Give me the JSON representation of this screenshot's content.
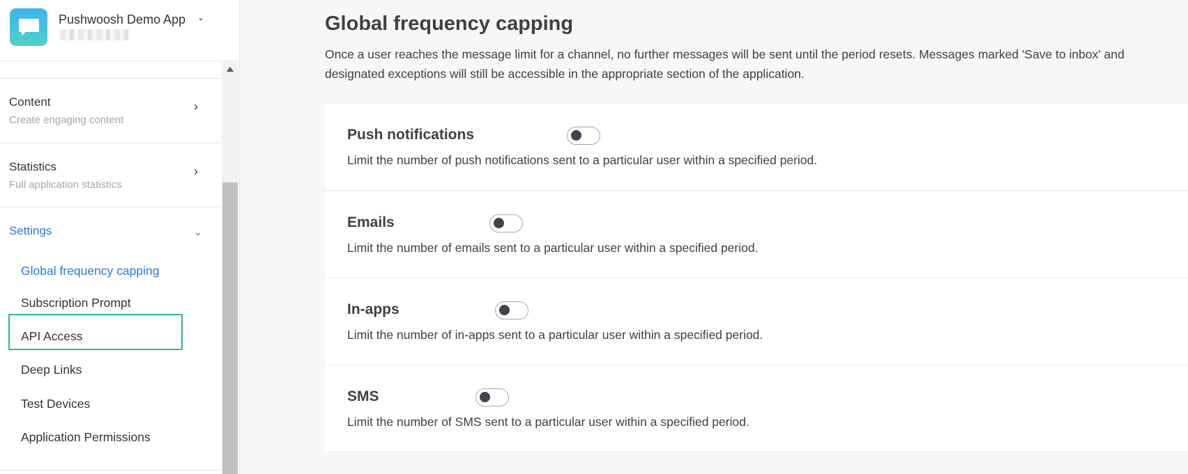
{
  "app": {
    "name": "Pushwoosh Demo App",
    "chevron": "⌄",
    "logo_icon": "chat-bubble-icon",
    "accent_color": "#2b78d8",
    "highlight_color": "#2fb88e"
  },
  "sidebar": {
    "sections": [
      {
        "title": "Content",
        "subtitle": "Create engaging content",
        "chevron": "›"
      },
      {
        "title": "Statistics",
        "subtitle": "Full application statistics",
        "chevron": "›"
      },
      {
        "title": "Settings",
        "chevron": "⌄"
      }
    ],
    "settings_items": [
      "Global frequency capping",
      "Subscription Prompt",
      "API Access",
      "Deep Links",
      "Test Devices",
      "Application Permissions"
    ],
    "current_item": "Global frequency capping"
  },
  "main": {
    "title": "Global frequency capping",
    "description": "Once a user reaches the message limit for a channel, no further messages will be sent until the period resets. Messages marked 'Save to inbox' and designated exceptions will still be accessible in the appropriate section of the application.",
    "channels": [
      {
        "name": "Push notifications",
        "description": "Limit the number of push notifications sent to a particular user within a specified period.",
        "enabled": false
      },
      {
        "name": "Emails",
        "description": "Limit the number of emails sent to a particular user within a specified period.",
        "enabled": false
      },
      {
        "name": "In-apps",
        "description": "Limit the number of in-apps sent to a particular user within a specified period.",
        "enabled": false
      },
      {
        "name": "SMS",
        "description": "Limit the number of SMS sent to a particular user within a specified period.",
        "enabled": false
      }
    ]
  }
}
